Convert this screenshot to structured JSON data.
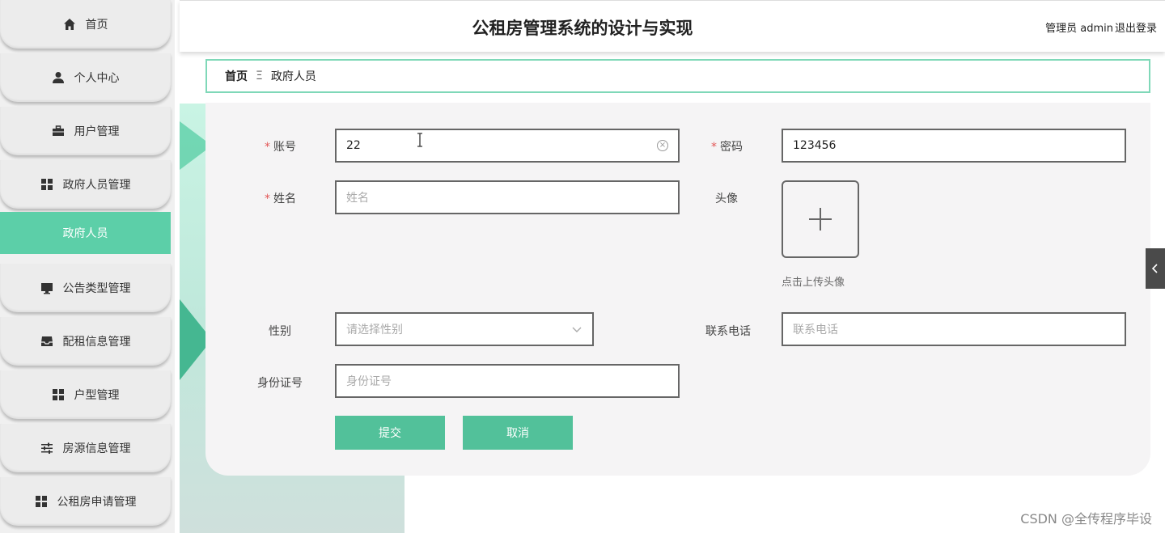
{
  "header": {
    "title": "公租房管理系统的设计与实现",
    "admin_label": "管理员 admin",
    "logout_label": "退出登录"
  },
  "sidebar": {
    "items": [
      {
        "label": "首页",
        "icon": "home-icon"
      },
      {
        "label": "个人中心",
        "icon": "user-icon"
      },
      {
        "label": "用户管理",
        "icon": "briefcase-icon"
      },
      {
        "label": "政府人员管理",
        "icon": "grid-icon"
      },
      {
        "label": "公告类型管理",
        "icon": "monitor-icon"
      },
      {
        "label": "配租信息管理",
        "icon": "inbox-icon"
      },
      {
        "label": "户型管理",
        "icon": "grid-icon"
      },
      {
        "label": "房源信息管理",
        "icon": "sliders-icon"
      },
      {
        "label": "公租房申请管理",
        "icon": "grid-icon"
      }
    ],
    "active_sub_item": "政府人员"
  },
  "breadcrumb": {
    "home": "首页",
    "separator": "Ξ",
    "current": "政府人员"
  },
  "form": {
    "account": {
      "label": "账号",
      "value": "22",
      "required": true
    },
    "password": {
      "label": "密码",
      "value": "123456",
      "required": true
    },
    "name": {
      "label": "姓名",
      "placeholder": "姓名",
      "required": true
    },
    "avatar": {
      "label": "头像",
      "hint": "点击上传头像"
    },
    "gender": {
      "label": "性别",
      "placeholder": "请选择性别"
    },
    "phone": {
      "label": "联系电话",
      "placeholder": "联系电话"
    },
    "id_number": {
      "label": "身份证号",
      "placeholder": "身份证号"
    },
    "required_mark": "*",
    "submit_label": "提交",
    "cancel_label": "取消"
  },
  "watermark": "CSDN @全传程序毕设",
  "colors": {
    "accent": "#5ccfa8",
    "button": "#52c19a",
    "required": "#e25656"
  }
}
